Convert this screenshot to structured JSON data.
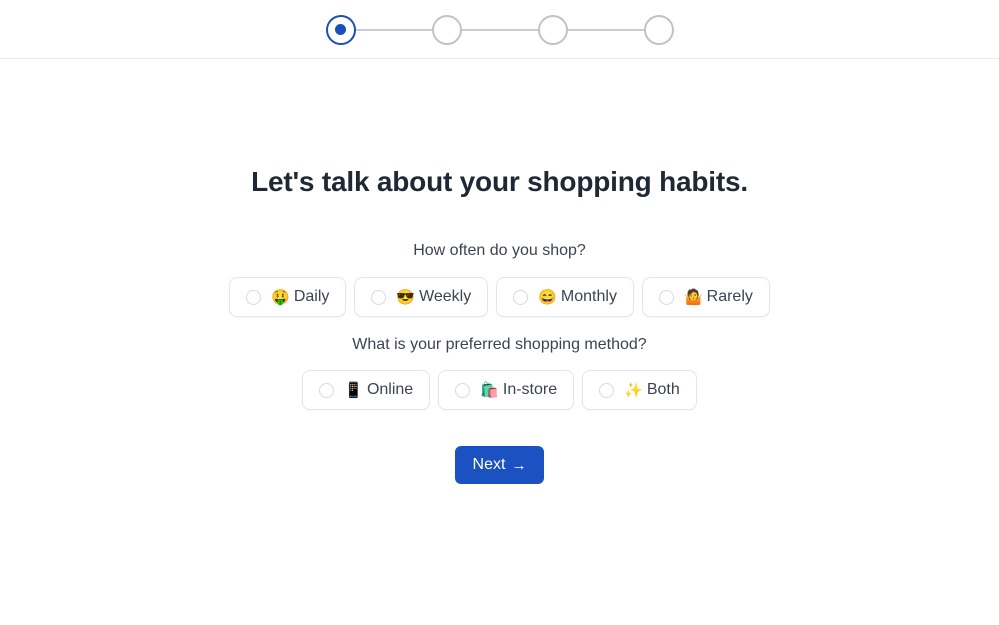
{
  "stepper": {
    "steps": [
      {
        "name": "step-1",
        "state": "active"
      },
      {
        "name": "step-2",
        "state": "inactive"
      },
      {
        "name": "step-3",
        "state": "inactive"
      },
      {
        "name": "step-4",
        "state": "inactive"
      }
    ],
    "current_step": 1,
    "total_steps": 4,
    "active_color": "#1a4fba",
    "inactive_color": "#bfc2c7"
  },
  "main": {
    "title": "Let's talk about your shopping habits.",
    "questions": [
      {
        "label": "How often do you shop?",
        "options": [
          {
            "emoji": "🤑",
            "emoji_name": "money-mouth-face-emoji",
            "label": "Daily",
            "selected": false
          },
          {
            "emoji": "😎",
            "emoji_name": "sunglasses-face-emoji",
            "label": "Weekly",
            "selected": false
          },
          {
            "emoji": "😄",
            "emoji_name": "grinning-face-emoji",
            "label": "Monthly",
            "selected": false
          },
          {
            "emoji": "🤷",
            "emoji_name": "shrug-emoji",
            "label": "Rarely",
            "selected": false
          }
        ]
      },
      {
        "label": "What is your preferred shopping method?",
        "options": [
          {
            "emoji": "📱",
            "emoji_name": "mobile-phone-emoji",
            "label": "Online",
            "selected": false
          },
          {
            "emoji": "🛍️",
            "emoji_name": "shopping-bags-emoji",
            "label": "In-store",
            "selected": false
          },
          {
            "emoji": "✨",
            "emoji_name": "sparkles-emoji",
            "label": "Both",
            "selected": false
          }
        ]
      }
    ]
  },
  "footer": {
    "next_label": "Next",
    "next_arrow": "→",
    "next_color": "#1c51c2"
  }
}
